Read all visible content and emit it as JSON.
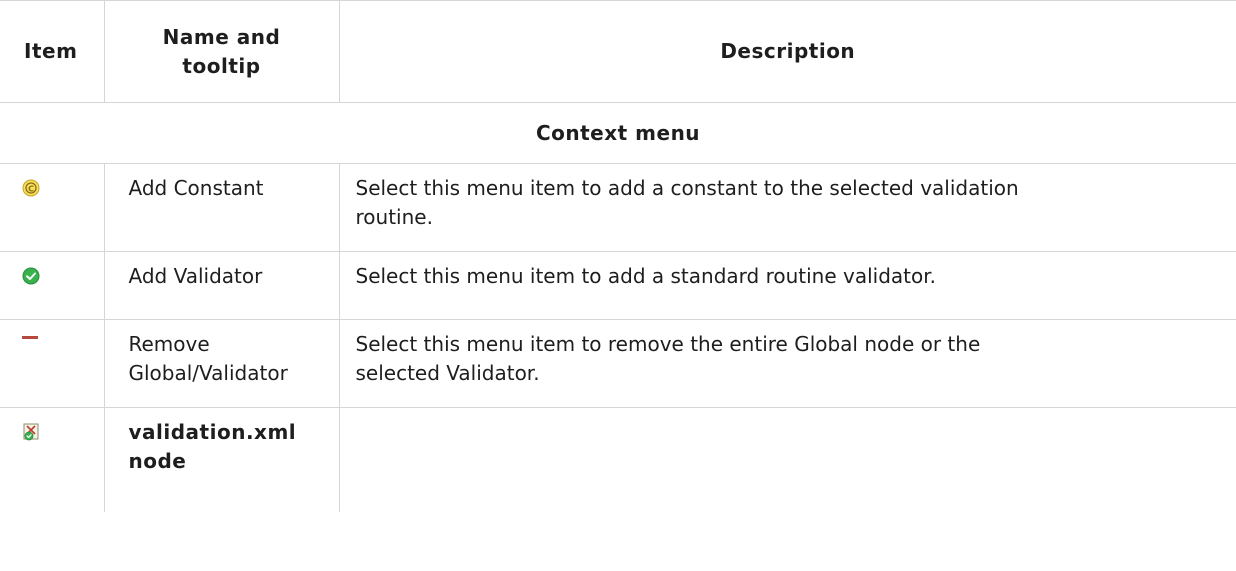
{
  "table": {
    "headers": {
      "item": "Item",
      "name_line1": "Name and",
      "name_line2": "tooltip",
      "description": "Description"
    },
    "section_title": "Context menu",
    "rows": [
      {
        "icon": "constant-icon",
        "name_line1": "Add Constant",
        "name_line2": "",
        "description_line1": "Select this menu item to add a constant to the selected validation",
        "description_line2": "routine."
      },
      {
        "icon": "validator-check-icon",
        "name_line1": "Add Validator",
        "name_line2": "",
        "description_line1": "Select this menu item to add a standard routine validator.",
        "description_line2": ""
      },
      {
        "icon": "remove-minus-icon",
        "name_line1": "Remove",
        "name_line2": "Global/Validator",
        "description_line1": "Select this menu item to remove the entire Global node or the",
        "description_line2": "selected Validator."
      },
      {
        "icon": "xml-validation-node-icon",
        "name_line1": "validation.xml",
        "name_line2": "node",
        "description_line1": "",
        "description_line2": ""
      }
    ]
  },
  "colors": {
    "border": "#d6d6d6",
    "text": "#1e1e1e",
    "constant_icon_fill": "#f6e05e",
    "check_icon_fill": "#2f9e44",
    "minus_icon": "#b5483f"
  }
}
